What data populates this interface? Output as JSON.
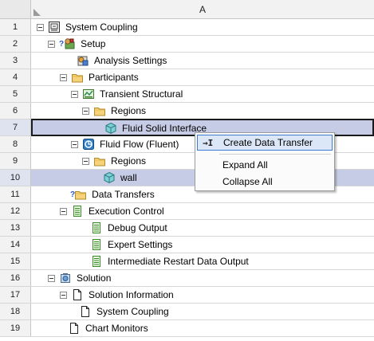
{
  "column_header": "A",
  "rows": [
    {
      "num": "1",
      "label": "System Coupling",
      "icon": "system-coupling-icon"
    },
    {
      "num": "2",
      "label": "Setup",
      "icon": "setup-icon"
    },
    {
      "num": "3",
      "label": "Analysis Settings",
      "icon": "analysis-settings-icon"
    },
    {
      "num": "4",
      "label": "Participants",
      "icon": "folder-icon"
    },
    {
      "num": "5",
      "label": "Transient Structural",
      "icon": "transient-structural-icon"
    },
    {
      "num": "6",
      "label": "Regions",
      "icon": "folder-icon"
    },
    {
      "num": "7",
      "label": "Fluid Solid Interface",
      "icon": "region-icon"
    },
    {
      "num": "8",
      "label": "Fluid Flow (Fluent)",
      "icon": "fluent-icon"
    },
    {
      "num": "9",
      "label": "Regions",
      "icon": "folder-icon"
    },
    {
      "num": "10",
      "label": "wall",
      "icon": "region-icon"
    },
    {
      "num": "11",
      "label": "Data Transfers",
      "icon": "folder-icon"
    },
    {
      "num": "12",
      "label": "Execution Control",
      "icon": "document-icon"
    },
    {
      "num": "13",
      "label": "Debug Output",
      "icon": "document-icon"
    },
    {
      "num": "14",
      "label": "Expert Settings",
      "icon": "document-icon"
    },
    {
      "num": "15",
      "label": "Intermediate Restart Data Output",
      "icon": "document-icon"
    },
    {
      "num": "16",
      "label": "Solution",
      "icon": "solution-icon"
    },
    {
      "num": "17",
      "label": "Solution Information",
      "icon": "page-icon"
    },
    {
      "num": "18",
      "label": "System Coupling",
      "icon": "page-icon"
    },
    {
      "num": "19",
      "label": "Chart Monitors",
      "icon": "page-icon"
    }
  ],
  "context_menu": {
    "items": [
      {
        "label": "Create Data Transfer",
        "icon": "create-data-transfer-icon",
        "icon_glyph": "→I"
      },
      {
        "label": "Expand All"
      },
      {
        "label": "Collapse All"
      }
    ]
  },
  "colors": {
    "selection": "#c6cce5",
    "menu_highlight": "#dbe6f6",
    "menu_highlight_border": "#3d7bd1",
    "header_bg": "#f2f2f2"
  }
}
